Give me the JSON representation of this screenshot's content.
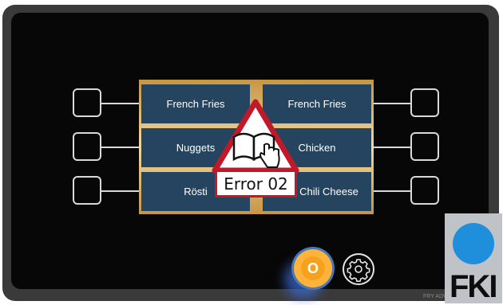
{
  "menu": {
    "left": [
      "French Fries",
      "Nuggets",
      "Rösti"
    ],
    "right": [
      "French Fries",
      "Chicken",
      "Chili Cheese"
    ]
  },
  "error": {
    "label": "Error 02",
    "icon": "manual-touch-warning-icon",
    "border_color": "#c0192a"
  },
  "controls": {
    "power_label": "O",
    "settings_icon": "gear-icon"
  },
  "brand": {
    "logo_text": "FKI",
    "model_label": "FRY ADV",
    "accent": "#1f8fdc"
  },
  "colors": {
    "button": "#25445f",
    "screen_gold": "#d6a85a",
    "power": "#f7a21f"
  }
}
